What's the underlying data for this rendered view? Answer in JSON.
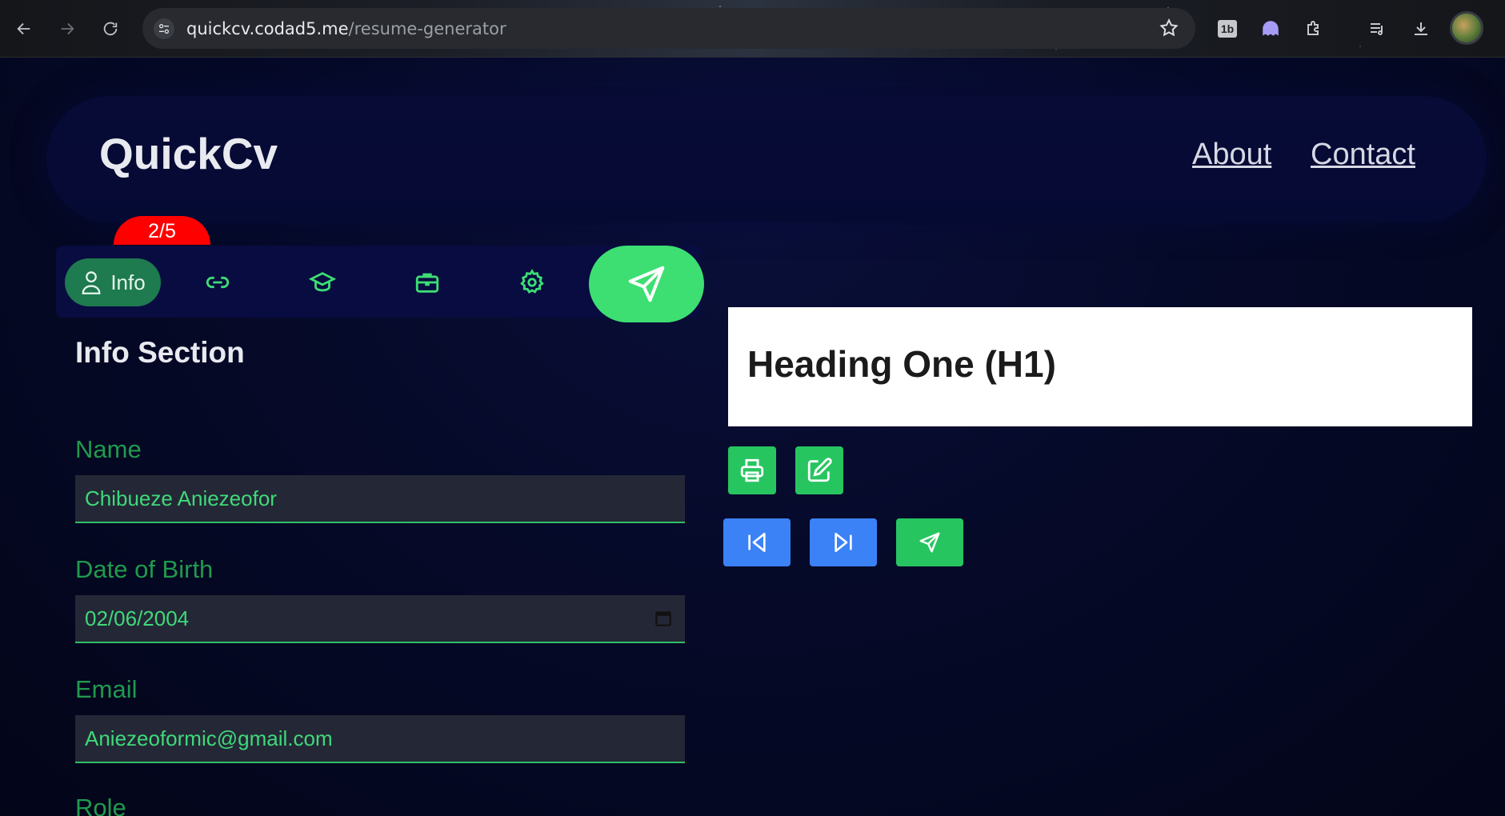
{
  "browser": {
    "url_domain": "quickcv.codad5.me",
    "url_path": "/resume-generator"
  },
  "header": {
    "logo": "QuickCv",
    "nav": [
      "About",
      "Contact"
    ]
  },
  "progress": {
    "badge": "2/5"
  },
  "tabs": {
    "active_label": "Info",
    "items": [
      "user-icon",
      "link-icon",
      "graduation-cap-icon",
      "briefcase-icon",
      "gear-icon"
    ]
  },
  "form": {
    "section_title": "Info Section",
    "fields": [
      {
        "label": "Name",
        "value": "Chibueze Aniezeofor"
      },
      {
        "label": "Date of Birth",
        "value": "02/06/2004"
      },
      {
        "label": "Email",
        "value": "Aniezeoformic@gmail.com"
      },
      {
        "label": "Role",
        "value": ""
      }
    ]
  },
  "preview": {
    "heading": "Heading One (H1)"
  },
  "colors": {
    "accent_green": "#3ddf73",
    "nav_blue": "#3b82f6",
    "badge_red": "#ff0000"
  }
}
